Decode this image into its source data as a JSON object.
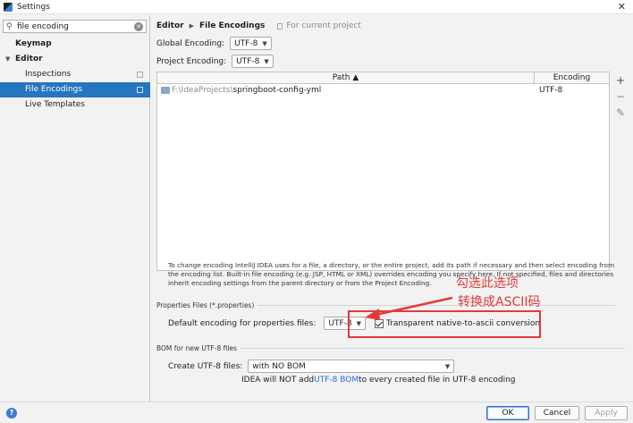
{
  "window": {
    "title": "Settings"
  },
  "sidebar": {
    "search_value": "file encoding",
    "items": [
      {
        "label": "Keymap"
      },
      {
        "label": "Editor"
      },
      {
        "label": "Inspections"
      },
      {
        "label": "File Encodings"
      },
      {
        "label": "Live Templates"
      }
    ]
  },
  "main": {
    "breadcrumb": {
      "parent": "Editor",
      "current": "File Encodings",
      "scope": "For current project"
    },
    "global_encoding": {
      "label": "Global Encoding:",
      "value": "UTF-8"
    },
    "project_encoding": {
      "label": "Project Encoding:",
      "value": "UTF-8"
    },
    "table": {
      "headers": {
        "path": "Path ▲",
        "encoding": "Encoding"
      },
      "rows": [
        {
          "path_prefix": "F:\\IdeaProjects\\",
          "path_name": "springboot-config-yml",
          "encoding": "UTF-8"
        }
      ]
    },
    "description": "To change encoding IntelliJ IDEA uses for a file, a directory, or the entire project, add its path if necessary and then select encoding from the encoding list. Built-in file encoding (e.g. JSP, HTML or XML) overrides encoding you specify here. If not specified, files and directories inherit encoding settings from the parent directory or from the Project Encoding.",
    "properties": {
      "section_title": "Properties Files (*.properties)",
      "default_label": "Default encoding for properties files:",
      "default_value": "UTF-8",
      "native_to_ascii_label": "Transparent native-to-ascii conversion",
      "native_to_ascii_checked": true
    },
    "bom": {
      "section_title": "BOM for new UTF-8 files",
      "create_label": "Create UTF-8 files:",
      "create_value": "with NO BOM",
      "note_prefix": "IDEA will NOT add ",
      "note_link": "UTF-8 BOM",
      "note_suffix": " to every created file in UTF-8 encoding"
    }
  },
  "annotation": {
    "line1": "勾选此选项",
    "line2": "转换成ASCII码",
    "color": "#e23a3a"
  },
  "buttons": {
    "ok": "OK",
    "cancel": "Cancel",
    "apply": "Apply",
    "help": "?"
  }
}
